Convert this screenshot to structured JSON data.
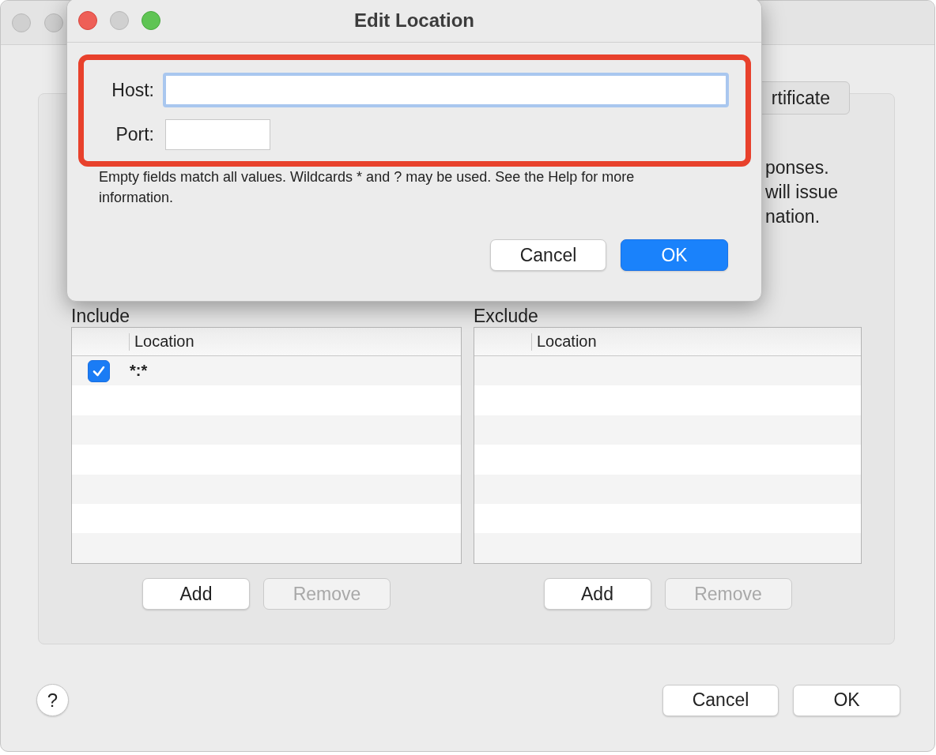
{
  "dialog": {
    "title": "Edit Location",
    "fields": [
      {
        "label": "Host:",
        "focused": true,
        "kind": "wide"
      },
      {
        "label": "Port:",
        "focused": false,
        "kind": "narrow"
      }
    ],
    "hint": "Empty fields match all values. Wildcards * and ? may be used. See the Help for more information.",
    "buttons": [
      {
        "label": "Cancel",
        "default": false
      },
      {
        "label": "OK",
        "default": true
      }
    ]
  },
  "tabs": [
    {
      "label": "rtificate",
      "selected": false
    }
  ],
  "description_lines": [
    "ponses.",
    "will issue",
    "nation."
  ],
  "tables": [
    {
      "title": "Include",
      "columns": [
        "Location"
      ],
      "rows": [
        {
          "checked": true,
          "location": "*:*"
        }
      ],
      "buttons": [
        {
          "label": "Add",
          "disabled": false
        },
        {
          "label": "Remove",
          "disabled": true
        }
      ]
    },
    {
      "title": "Exclude",
      "columns": [
        "Location"
      ],
      "buttons": [
        {
          "label": "Add",
          "disabled": false
        },
        {
          "label": "Remove",
          "disabled": true
        }
      ]
    }
  ],
  "help_button": "?",
  "buttons": [
    {
      "label": "Cancel",
      "default": false
    },
    {
      "label": "OK",
      "default": false
    }
  ]
}
